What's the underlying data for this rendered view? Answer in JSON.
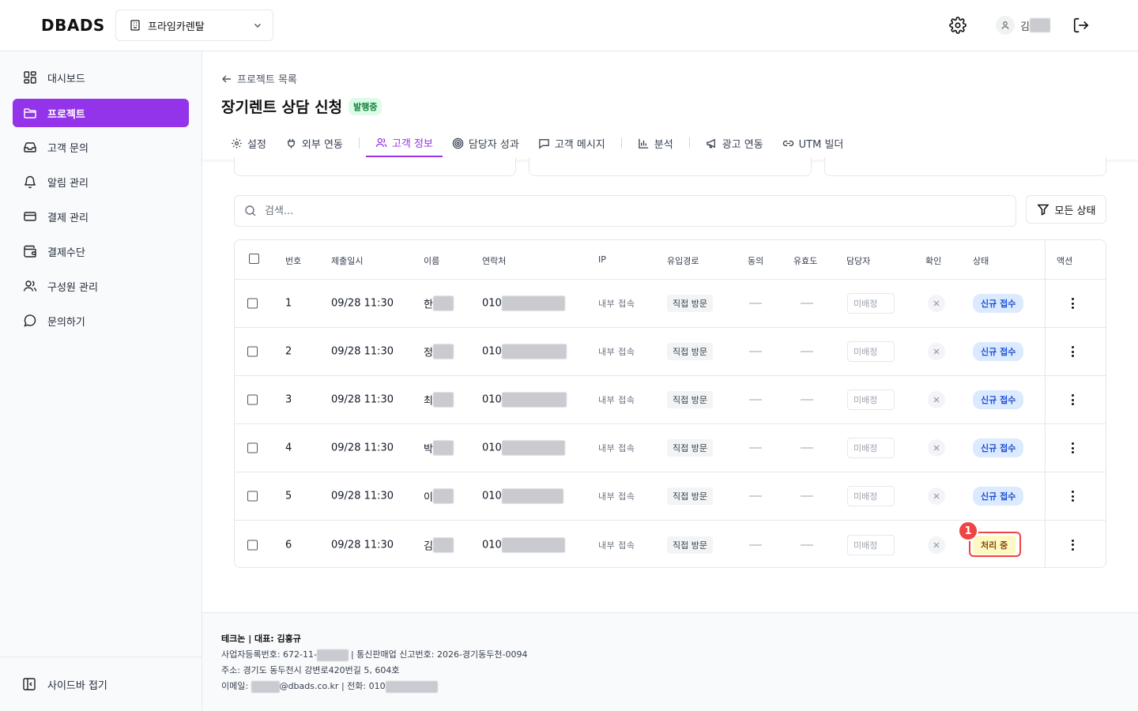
{
  "app": {
    "logo": "DBADS",
    "org_name": "프라임카렌탈",
    "user_name_visible": "김"
  },
  "sidebar": {
    "items": [
      {
        "label": "대시보드",
        "icon": "dashboard-icon"
      },
      {
        "label": "프로젝트",
        "icon": "folder-icon",
        "active": true
      },
      {
        "label": "고객 문의",
        "icon": "inbox-icon"
      },
      {
        "label": "알림 관리",
        "icon": "bell-icon"
      },
      {
        "label": "결제 관리",
        "icon": "credit-card-icon"
      },
      {
        "label": "결제수단",
        "icon": "wallet-icon"
      },
      {
        "label": "구성원 관리",
        "icon": "users-icon"
      },
      {
        "label": "문의하기",
        "icon": "chat-icon"
      }
    ],
    "collapse_label": "사이드바 접기"
  },
  "page": {
    "back_label": "프로젝트 목록",
    "title": "장기렌트 상담 신청",
    "status_badge": "발행중"
  },
  "tabs": [
    {
      "label": "설정",
      "icon": "gear-icon"
    },
    {
      "label": "외부 연동",
      "icon": "plug-icon"
    },
    {
      "label": "고객 정보",
      "icon": "users-icon",
      "active": true
    },
    {
      "label": "담당자 성과",
      "icon": "target-icon"
    },
    {
      "label": "고객 메시지",
      "icon": "message-icon"
    },
    {
      "label": "분석",
      "icon": "chart-icon"
    },
    {
      "label": "광고 연동",
      "icon": "megaphone-icon"
    },
    {
      "label": "UTM 빌더",
      "icon": "link-icon"
    }
  ],
  "search": {
    "placeholder": "검색..."
  },
  "filter": {
    "label": "모든 상태"
  },
  "table": {
    "headers": [
      "번호",
      "제출일시",
      "이름",
      "연락처",
      "IP",
      "유입경로",
      "동의",
      "유효도",
      "담당자",
      "확인",
      "상태",
      "액션"
    ],
    "rows": [
      {
        "no": "1",
        "date": "09/28 11:30",
        "name": "한",
        "phone": "010",
        "ip": "내부 접속",
        "route": "직접 방문",
        "assignee": "미배정",
        "status": "신규 접수",
        "status_type": "new"
      },
      {
        "no": "2",
        "date": "09/28 11:30",
        "name": "정",
        "phone": "010",
        "ip": "내부 접속",
        "route": "직접 방문",
        "assignee": "미배정",
        "status": "신규 접수",
        "status_type": "new"
      },
      {
        "no": "3",
        "date": "09/28 11:30",
        "name": "최",
        "phone": "010",
        "ip": "내부 접속",
        "route": "직접 방문",
        "assignee": "미배정",
        "status": "신규 접수",
        "status_type": "new"
      },
      {
        "no": "4",
        "date": "09/28 11:30",
        "name": "박",
        "phone": "010",
        "ip": "내부 접속",
        "route": "직접 방문",
        "assignee": "미배정",
        "status": "신규 접수",
        "status_type": "new"
      },
      {
        "no": "5",
        "date": "09/28 11:30",
        "name": "이",
        "phone": "010",
        "ip": "내부 접속",
        "route": "직접 방문",
        "assignee": "미배정",
        "status": "신규 접수",
        "status_type": "new"
      },
      {
        "no": "6",
        "date": "09/28 11:30",
        "name": "김",
        "phone": "010",
        "ip": "내부 접속",
        "route": "직접 방문",
        "assignee": "미배정",
        "status": "처리 중",
        "status_type": "processing"
      }
    ]
  },
  "annotation": {
    "step_number": "1"
  },
  "footer": {
    "company": "테크논 | 대표: 김홍규",
    "biz_prefix": "사업자등록번호: 672-11-",
    "biz_suffix": "| 통신판매업 신고번호: 2026-경기동두천-0094",
    "address": "주소: 경기도 동두천시 강변로420번길 5, 604호",
    "email_prefix": "이메일: ",
    "email_suffix": "@dbads.co.kr | 전화: 010"
  },
  "colors": {
    "accent": "#9333ea",
    "status_new_bg": "#dbeafe",
    "status_new_text": "#1d4ed8",
    "status_processing_bg": "#fef9c3",
    "highlight": "#ef4444",
    "published_bg": "#dcfce7"
  }
}
